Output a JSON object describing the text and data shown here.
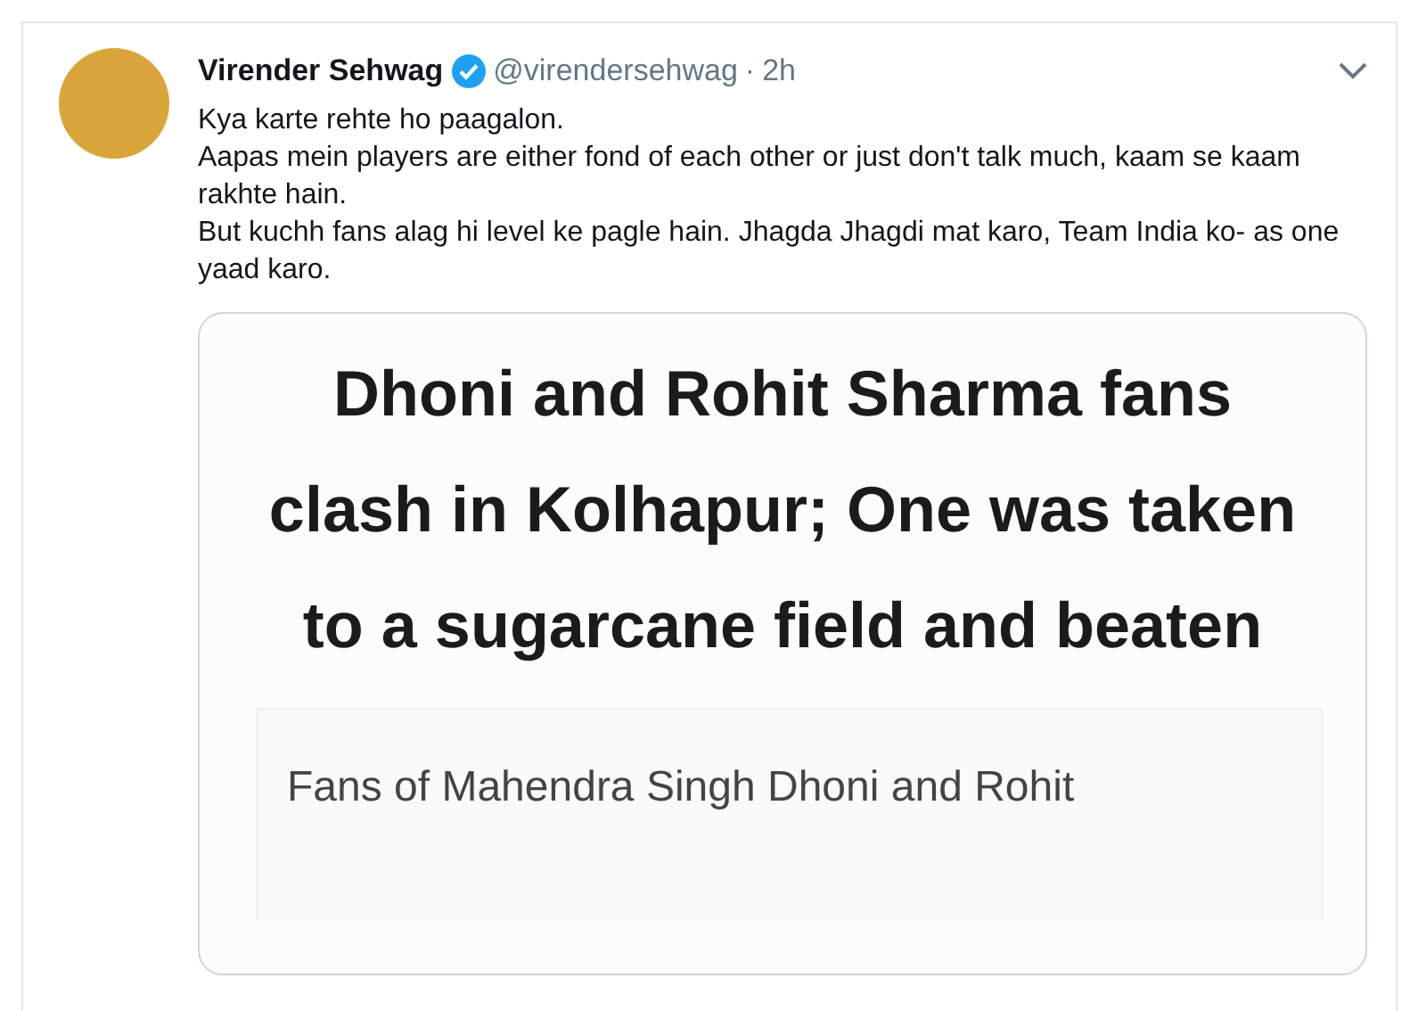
{
  "tweet": {
    "author_name": "Virender Sehwag",
    "verified": true,
    "handle": "@virendersehwag",
    "separator": "·",
    "time": "2h",
    "text_lines": [
      "Kya karte rehte ho paagalon.",
      "Aapas mein players are either fond of each other or just don't talk much, kaam se kaam rakhte hain.",
      "But kuchh fans alag hi level ke pagle hain. Jhagda Jhagdi mat karo, Team India ko- as one yaad karo."
    ],
    "media": {
      "headline": "Dhoni and Rohit Sharma fans clash in Kolhapur; One was taken to a sugarcane field and beaten",
      "article_excerpt": "Fans of Mahendra Singh Dhoni and Rohit"
    }
  }
}
